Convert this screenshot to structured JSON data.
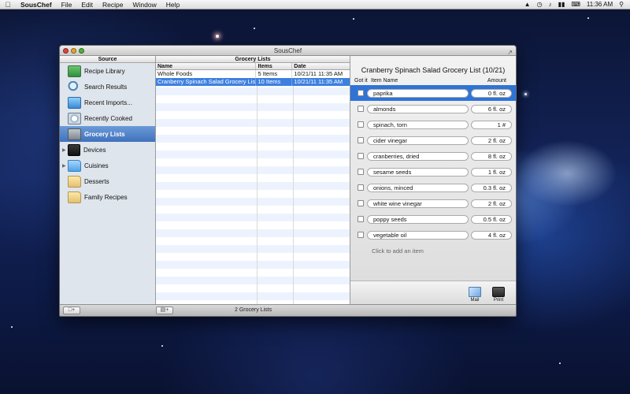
{
  "menubar": {
    "apple_icon": "apple-logo-icon",
    "items": [
      "SousChef",
      "File",
      "Edit",
      "Recipe",
      "Window",
      "Help"
    ],
    "clock": "11:36 AM",
    "status_icons": [
      "wifi-icon",
      "timemachine-icon",
      "volume-icon",
      "battery-icon",
      "keyboard-icon",
      "spotlight-icon"
    ]
  },
  "window": {
    "title": "SousChef"
  },
  "source": {
    "header": "Source",
    "items": [
      {
        "label": "Recipe Library",
        "icon": "recipe-library-icon"
      },
      {
        "label": "Search Results",
        "icon": "search-results-icon"
      },
      {
        "label": "Recent Imports...",
        "icon": "recent-imports-icon"
      },
      {
        "label": "Recently Cooked",
        "icon": "recently-cooked-icon"
      },
      {
        "label": "Grocery Lists",
        "icon": "grocery-list-icon",
        "selected": true
      },
      {
        "label": "Devices",
        "icon": "devices-icon"
      },
      {
        "label": "Cuisines",
        "icon": "folder-icon"
      },
      {
        "label": "Desserts",
        "icon": "folder-icon"
      },
      {
        "label": "Family Recipes",
        "icon": "folder-icon"
      }
    ]
  },
  "lists": {
    "header": "Grocery Lists",
    "columns": [
      "Name",
      "Items",
      "Date"
    ],
    "rows": [
      {
        "name": "Whole Foods",
        "items": "5 Items",
        "date": "10/21/11 11:35 AM"
      },
      {
        "name": "Cranberry Spinach Salad Grocery Lis...",
        "items": "10 Items",
        "date": "10/21/11 11:35 AM",
        "selected": true
      }
    ]
  },
  "detail": {
    "title": "Cranberry Spinach Salad Grocery List (10/21)",
    "col_got": "Got it",
    "col_name": "Item Name",
    "col_amount": "Amount",
    "items": [
      {
        "name": "paprika",
        "amount": "0 fl. oz"
      },
      {
        "name": "almonds",
        "amount": "6 fl. oz"
      },
      {
        "name": "spinach, torn",
        "amount": "1 #"
      },
      {
        "name": "cider vinegar",
        "amount": "2 fl. oz"
      },
      {
        "name": "cranberries, dried",
        "amount": "8 fl. oz"
      },
      {
        "name": "sesame seeds",
        "amount": "1 fl. oz"
      },
      {
        "name": "onions, minced",
        "amount": "0.3 fl. oz"
      },
      {
        "name": "white wine vinegar",
        "amount": "2 fl. oz"
      },
      {
        "name": "poppy seeds",
        "amount": "0.5 fl. oz"
      },
      {
        "name": "vegetable oil",
        "amount": "4 fl. oz"
      }
    ],
    "add_hint": "Click to add an item",
    "mail_label": "Mail",
    "print_label": "Print"
  },
  "status": {
    "add_folder_button": "+",
    "add_list_button": "+",
    "count_text": "2 Grocery Lists"
  }
}
